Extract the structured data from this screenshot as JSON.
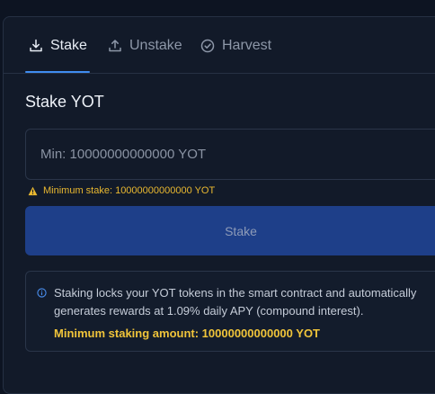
{
  "tabs": [
    {
      "label": "Stake",
      "icon": "download-icon",
      "active": true
    },
    {
      "label": "Unstake",
      "icon": "upload-icon",
      "active": false
    },
    {
      "label": "Harvest",
      "icon": "check-circle-icon",
      "active": false
    }
  ],
  "form": {
    "title": "Stake YOT",
    "amount_placeholder": "Min: 10000000000000 YOT",
    "amount_value": "",
    "warning": "Minimum stake: 10000000000000 YOT",
    "submit_label": "Stake"
  },
  "info": {
    "text": "Staking locks your YOT tokens in the smart contract and automatically generates rewards at 1.09% daily APY (compound interest).",
    "minimum": "Minimum staking amount: 10000000000000 YOT"
  },
  "colors": {
    "accent": "#3f8cf0",
    "button": "#1e3f89",
    "warning": "#e9b830",
    "background": "#121a29"
  }
}
